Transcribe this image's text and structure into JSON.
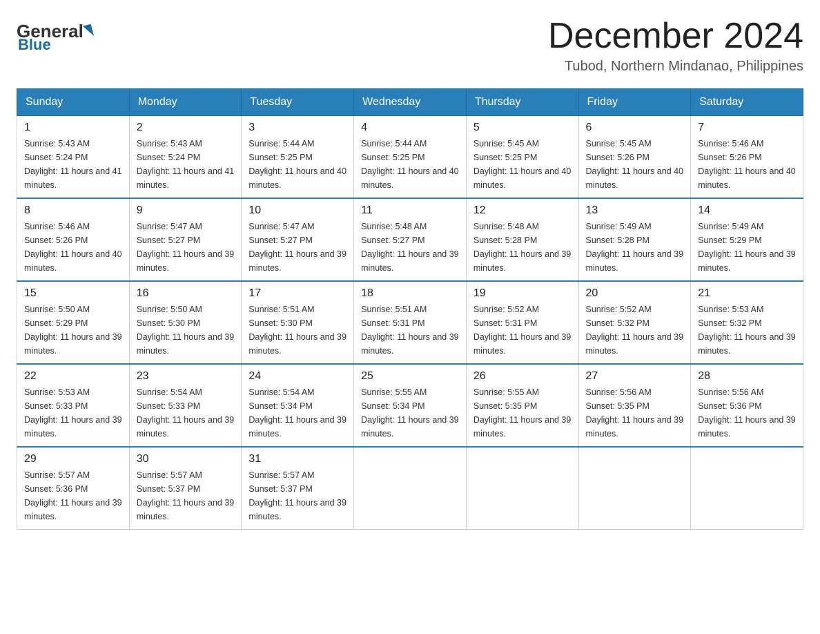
{
  "logo": {
    "general": "General",
    "blue": "Blue"
  },
  "title": "December 2024",
  "location": "Tubod, Northern Mindanao, Philippines",
  "days_of_week": [
    "Sunday",
    "Monday",
    "Tuesday",
    "Wednesday",
    "Thursday",
    "Friday",
    "Saturday"
  ],
  "weeks": [
    [
      {
        "day": "1",
        "sunrise": "5:43 AM",
        "sunset": "5:24 PM",
        "daylight": "11 hours and 41 minutes."
      },
      {
        "day": "2",
        "sunrise": "5:43 AM",
        "sunset": "5:24 PM",
        "daylight": "11 hours and 41 minutes."
      },
      {
        "day": "3",
        "sunrise": "5:44 AM",
        "sunset": "5:25 PM",
        "daylight": "11 hours and 40 minutes."
      },
      {
        "day": "4",
        "sunrise": "5:44 AM",
        "sunset": "5:25 PM",
        "daylight": "11 hours and 40 minutes."
      },
      {
        "day": "5",
        "sunrise": "5:45 AM",
        "sunset": "5:25 PM",
        "daylight": "11 hours and 40 minutes."
      },
      {
        "day": "6",
        "sunrise": "5:45 AM",
        "sunset": "5:26 PM",
        "daylight": "11 hours and 40 minutes."
      },
      {
        "day": "7",
        "sunrise": "5:46 AM",
        "sunset": "5:26 PM",
        "daylight": "11 hours and 40 minutes."
      }
    ],
    [
      {
        "day": "8",
        "sunrise": "5:46 AM",
        "sunset": "5:26 PM",
        "daylight": "11 hours and 40 minutes."
      },
      {
        "day": "9",
        "sunrise": "5:47 AM",
        "sunset": "5:27 PM",
        "daylight": "11 hours and 39 minutes."
      },
      {
        "day": "10",
        "sunrise": "5:47 AM",
        "sunset": "5:27 PM",
        "daylight": "11 hours and 39 minutes."
      },
      {
        "day": "11",
        "sunrise": "5:48 AM",
        "sunset": "5:27 PM",
        "daylight": "11 hours and 39 minutes."
      },
      {
        "day": "12",
        "sunrise": "5:48 AM",
        "sunset": "5:28 PM",
        "daylight": "11 hours and 39 minutes."
      },
      {
        "day": "13",
        "sunrise": "5:49 AM",
        "sunset": "5:28 PM",
        "daylight": "11 hours and 39 minutes."
      },
      {
        "day": "14",
        "sunrise": "5:49 AM",
        "sunset": "5:29 PM",
        "daylight": "11 hours and 39 minutes."
      }
    ],
    [
      {
        "day": "15",
        "sunrise": "5:50 AM",
        "sunset": "5:29 PM",
        "daylight": "11 hours and 39 minutes."
      },
      {
        "day": "16",
        "sunrise": "5:50 AM",
        "sunset": "5:30 PM",
        "daylight": "11 hours and 39 minutes."
      },
      {
        "day": "17",
        "sunrise": "5:51 AM",
        "sunset": "5:30 PM",
        "daylight": "11 hours and 39 minutes."
      },
      {
        "day": "18",
        "sunrise": "5:51 AM",
        "sunset": "5:31 PM",
        "daylight": "11 hours and 39 minutes."
      },
      {
        "day": "19",
        "sunrise": "5:52 AM",
        "sunset": "5:31 PM",
        "daylight": "11 hours and 39 minutes."
      },
      {
        "day": "20",
        "sunrise": "5:52 AM",
        "sunset": "5:32 PM",
        "daylight": "11 hours and 39 minutes."
      },
      {
        "day": "21",
        "sunrise": "5:53 AM",
        "sunset": "5:32 PM",
        "daylight": "11 hours and 39 minutes."
      }
    ],
    [
      {
        "day": "22",
        "sunrise": "5:53 AM",
        "sunset": "5:33 PM",
        "daylight": "11 hours and 39 minutes."
      },
      {
        "day": "23",
        "sunrise": "5:54 AM",
        "sunset": "5:33 PM",
        "daylight": "11 hours and 39 minutes."
      },
      {
        "day": "24",
        "sunrise": "5:54 AM",
        "sunset": "5:34 PM",
        "daylight": "11 hours and 39 minutes."
      },
      {
        "day": "25",
        "sunrise": "5:55 AM",
        "sunset": "5:34 PM",
        "daylight": "11 hours and 39 minutes."
      },
      {
        "day": "26",
        "sunrise": "5:55 AM",
        "sunset": "5:35 PM",
        "daylight": "11 hours and 39 minutes."
      },
      {
        "day": "27",
        "sunrise": "5:56 AM",
        "sunset": "5:35 PM",
        "daylight": "11 hours and 39 minutes."
      },
      {
        "day": "28",
        "sunrise": "5:56 AM",
        "sunset": "5:36 PM",
        "daylight": "11 hours and 39 minutes."
      }
    ],
    [
      {
        "day": "29",
        "sunrise": "5:57 AM",
        "sunset": "5:36 PM",
        "daylight": "11 hours and 39 minutes."
      },
      {
        "day": "30",
        "sunrise": "5:57 AM",
        "sunset": "5:37 PM",
        "daylight": "11 hours and 39 minutes."
      },
      {
        "day": "31",
        "sunrise": "5:57 AM",
        "sunset": "5:37 PM",
        "daylight": "11 hours and 39 minutes."
      },
      null,
      null,
      null,
      null
    ]
  ]
}
